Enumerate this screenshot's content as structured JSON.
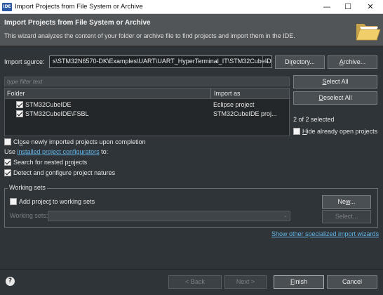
{
  "window": {
    "app_icon": "IDE",
    "title": "Import Projects from File System or Archive",
    "minimize_glyph": "—",
    "maximize_glyph": "☐",
    "close_glyph": "✕"
  },
  "header": {
    "title": "Import Projects from File System or Archive",
    "description": "This wizard analyzes the content of your folder or archive file to find projects and import them in the IDE.",
    "icon": "folder-open-icon"
  },
  "import_source": {
    "label_prefix": "Import s",
    "label_mnemonic": "o",
    "label_suffix": "urce:",
    "value": "s\\STM32N6570-DK\\Examples\\UART\\UART_HyperTerminal_IT\\STM32CubeIDE",
    "dropdown_icon": "chevron-down-icon",
    "dropdown_glyph": "⌄",
    "directory_button": {
      "prefix": "Di",
      "mnemonic": "r",
      "suffix": "ectory..."
    },
    "archive_button": {
      "prefix": "",
      "mnemonic": "A",
      "suffix": "rchive..."
    }
  },
  "filter": {
    "placeholder": "type filter text"
  },
  "table": {
    "columns": [
      "Folder",
      "Import as"
    ],
    "rows": [
      {
        "folder": "STM32CubeIDE",
        "import_as": "Eclipse project",
        "checked": true
      },
      {
        "folder": "STM32CubeIDE\\FSBL",
        "import_as": "STM32CubeIDE proj...",
        "checked": true
      }
    ]
  },
  "side": {
    "select_all": {
      "prefix": "",
      "mnemonic": "S",
      "suffix": "elect All"
    },
    "deselect_all": {
      "prefix": "",
      "mnemonic": "D",
      "suffix": "eselect All"
    },
    "selected_count": "2 of 2 selected",
    "hide_open": {
      "prefix": "",
      "mnemonic": "H",
      "suffix": "ide already open projects",
      "checked": false
    }
  },
  "options": {
    "close_newly": {
      "prefix": "Cl",
      "mnemonic": "o",
      "suffix": "se newly imported projects upon completion",
      "checked": false
    },
    "use_prefix": "Use ",
    "configurators_link": "installed project configurators",
    "use_suffix": " to:",
    "search_nested": {
      "prefix": "Search for nested p",
      "mnemonic": "r",
      "suffix": "ojects",
      "checked": true
    },
    "detect_configure": {
      "prefix": "Detect and ",
      "mnemonic": "c",
      "suffix": "onfigure project natures",
      "checked": true
    }
  },
  "working_sets": {
    "legend": "Working sets",
    "add_to": {
      "prefix": "Add projec",
      "mnemonic": "t",
      "suffix": " to working sets",
      "checked": false
    },
    "new_button": {
      "prefix": "Ne",
      "mnemonic": "w",
      "suffix": "..."
    },
    "label": "Working sets:",
    "select_button": "Select...",
    "dropdown_glyph": "⌄"
  },
  "specialized_link": "Show other specialized import wizards",
  "footer": {
    "help_glyph": "?",
    "back": "< Back",
    "next": "Next >",
    "finish": {
      "prefix": "",
      "mnemonic": "F",
      "suffix": "inish"
    },
    "cancel": "Cancel"
  }
}
